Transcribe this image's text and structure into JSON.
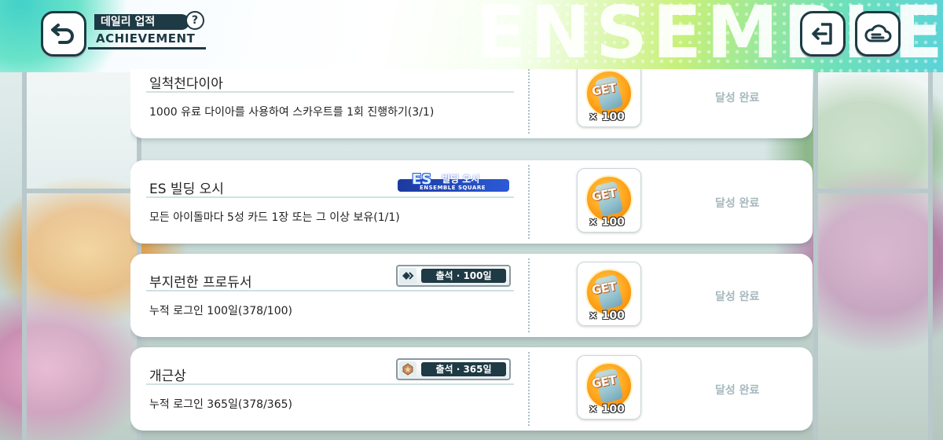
{
  "header": {
    "title_kr": "데일리 업적",
    "title_en": "ACHIEVEMENT",
    "help_label": "?",
    "banner_word": "ENSEMBLE"
  },
  "colors": {
    "navy": "#1e3a44",
    "status_done": "#a6b8bd",
    "reward_orange": "#ffa31a"
  },
  "icons": {
    "back": "back-arrow-icon",
    "help": "question-icon",
    "exit": "exit-icon",
    "cloud": "cloud-icon"
  },
  "achievements": [
    {
      "title": "일척천다이아",
      "description": "1000 유료 다이아를 사용하여 스카우트를 1회 진행하기(3/1)",
      "badge": null,
      "reward": {
        "label": "GET",
        "quantity": "× 100"
      },
      "status": "달성 완료"
    },
    {
      "title": "ES 빌딩 오시",
      "description": "모든 아이돌마다 5성 카드 1장 또는 그 이상 보유(1/1)",
      "badge": {
        "big": "ES",
        "kr": "빌딩 오시",
        "sub": "ENSEMBLE SQUARE"
      },
      "reward": {
        "label": "GET",
        "quantity": "× 100"
      },
      "status": "달성 완료"
    },
    {
      "title": "부지런한 프로듀서",
      "description": "누적 로그인 100일(378/100)",
      "badge": {
        "text": "출석 · 100일"
      },
      "reward": {
        "label": "GET",
        "quantity": "× 100"
      },
      "status": "달성 완료"
    },
    {
      "title": "개근상",
      "description": "누적 로그인 365일(378/365)",
      "badge": {
        "text": "출석 · 365일"
      },
      "reward": {
        "label": "GET",
        "quantity": "× 100"
      },
      "status": "달성 완료"
    }
  ]
}
